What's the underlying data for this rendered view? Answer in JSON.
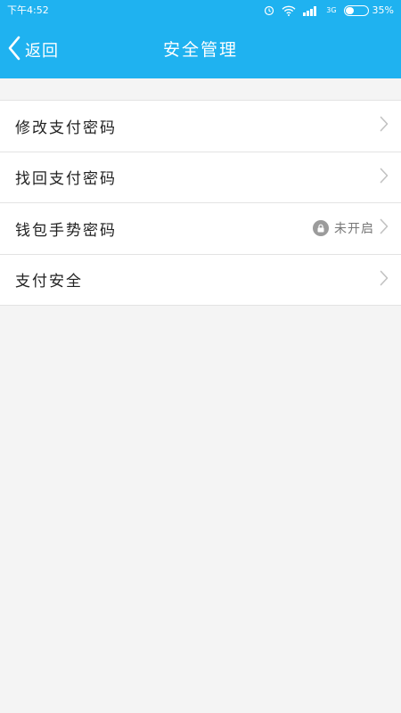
{
  "statusbar": {
    "time": "下午4:52",
    "network_label": "3G",
    "battery_percent": "35%",
    "battery_level": 0.35
  },
  "toolbar": {
    "back_label": "返回",
    "title": "安全管理"
  },
  "list": {
    "items": [
      {
        "label": "修改支付密码",
        "status": ""
      },
      {
        "label": "找回支付密码",
        "status": ""
      },
      {
        "label": "钱包手势密码",
        "status": "未开启"
      },
      {
        "label": "支付安全",
        "status": ""
      }
    ]
  },
  "colors": {
    "primary": "#1fb2f0",
    "background": "#f4f4f4",
    "divider": "#e3e3e3",
    "chevron": "#c2c2c2"
  },
  "icons": {
    "back": "chevron-left-icon",
    "row_arrow": "chevron-right-icon",
    "lock": "lock-icon"
  }
}
